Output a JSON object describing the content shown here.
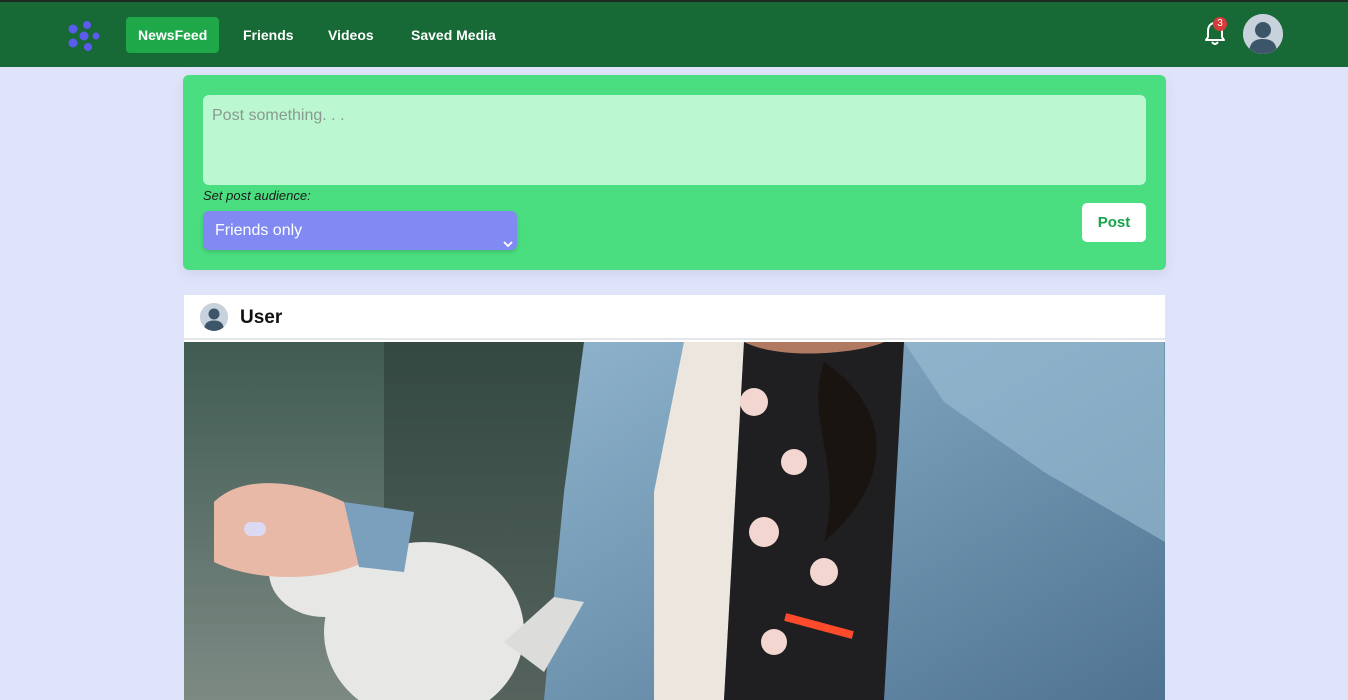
{
  "nav": {
    "items": [
      {
        "label": "NewsFeed",
        "active": true
      },
      {
        "label": "Friends",
        "active": false
      },
      {
        "label": "Videos",
        "active": false
      },
      {
        "label": "Saved Media",
        "active": false
      }
    ],
    "notification_count": "3",
    "icons": {
      "logo": "logo-icon",
      "notifications": "bell-icon",
      "profile": "avatar-icon"
    }
  },
  "composer": {
    "placeholder": "Post something. . .",
    "value": "",
    "audience_label": "Set post audience:",
    "audience_value": "Friends only",
    "post_label": "Post"
  },
  "feed": {
    "posts": [
      {
        "username": "User",
        "image": "photo of a person in a denim jacket pouring from a white teapot"
      }
    ]
  },
  "colors": {
    "navbar": "#176936",
    "nav_active": "#1fa84a",
    "page_background": "#e0e4fb",
    "composer_background": "#4ade80",
    "input_background": "#bbf7d0",
    "select_background": "#8189f3",
    "post_button_text": "#16a34a",
    "badge": "#d63b3b",
    "logo": "#5b5bf0"
  }
}
